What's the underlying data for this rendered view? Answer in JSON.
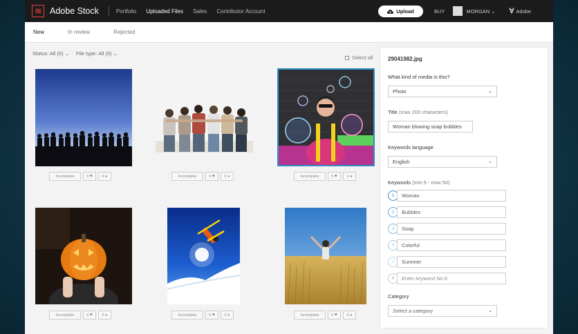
{
  "topbar": {
    "logo": "St",
    "brand": "Adobe Stock",
    "nav": [
      "Portfolio",
      "Uploaded Files",
      "Sales",
      "Contributor Account"
    ],
    "active_nav": "Uploaded Files",
    "upload_label": "Upload",
    "buy_label": "BUY",
    "user_name": "MORGAN",
    "adobe_label": "Adobe"
  },
  "tabs": [
    "New",
    "In review",
    "Rejected"
  ],
  "filters": {
    "status": "Status: All (6)",
    "file_type": "File type: All (6)",
    "select_all": "Select all"
  },
  "grid": [
    {
      "status": "Incomplete",
      "keywords": "0",
      "people": "0",
      "selected": false,
      "subject": "silhouettes"
    },
    {
      "status": "Incomplete",
      "keywords": "0",
      "people": "0",
      "selected": false,
      "subject": "friends"
    },
    {
      "status": "Incomplete",
      "keywords": "5",
      "people": "1",
      "selected": true,
      "subject": "bubbles"
    },
    {
      "status": "Incomplete",
      "keywords": "0",
      "people": "0",
      "selected": false,
      "subject": "pumpkin"
    },
    {
      "status": "Incomplete",
      "keywords": "0",
      "people": "0",
      "selected": false,
      "subject": "skier"
    },
    {
      "status": "Incomplete",
      "keywords": "0",
      "people": "0",
      "selected": false,
      "subject": "wheat"
    }
  ],
  "panel": {
    "filename": "29041982.jpg",
    "media_label": "What kind of media is this?",
    "media_value": "Photo",
    "title_label": "Title",
    "title_hint": "(max 200 characters)",
    "title_value": "Woman blowing soap bubbles",
    "lang_label": "Keywords language",
    "lang_value": "English",
    "keywords_label": "Keywords",
    "keywords_hint": "(min 5 - max 50)",
    "keywords": [
      "Woman",
      "Bubbles",
      "Soap",
      "Colorful",
      "Summer"
    ],
    "keyword_placeholder": "Enter keyword No.6",
    "category_label": "Category",
    "category_placeholder": "Select a category"
  },
  "colors": {
    "accent": "#2c8ec5",
    "logo_red": "#ee3d3d",
    "topbar": "#1b1b1b"
  }
}
